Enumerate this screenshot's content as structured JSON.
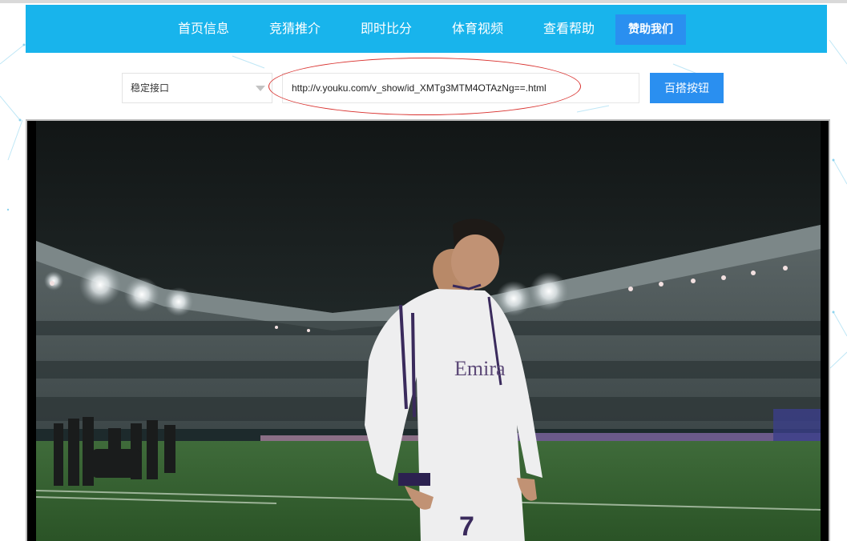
{
  "nav": {
    "items": [
      {
        "label": "首页信息"
      },
      {
        "label": "竞猜推介"
      },
      {
        "label": "即时比分"
      },
      {
        "label": "体育视频"
      },
      {
        "label": "查看帮助"
      },
      {
        "label": "赞助我们"
      }
    ],
    "active_label": "赞助我们"
  },
  "toolbar": {
    "select_value": "稳定接口",
    "url_value": "http://v.youku.com/v_show/id_XMTg3MTM4OTAzNg==.html",
    "search_label": "百搭按钮"
  },
  "video": {
    "player_number": "7",
    "shirt_text": "Emira"
  },
  "colors": {
    "nav_bg": "#18b4ec",
    "accent": "#2a8ff0",
    "highlight": "#d9322f"
  }
}
